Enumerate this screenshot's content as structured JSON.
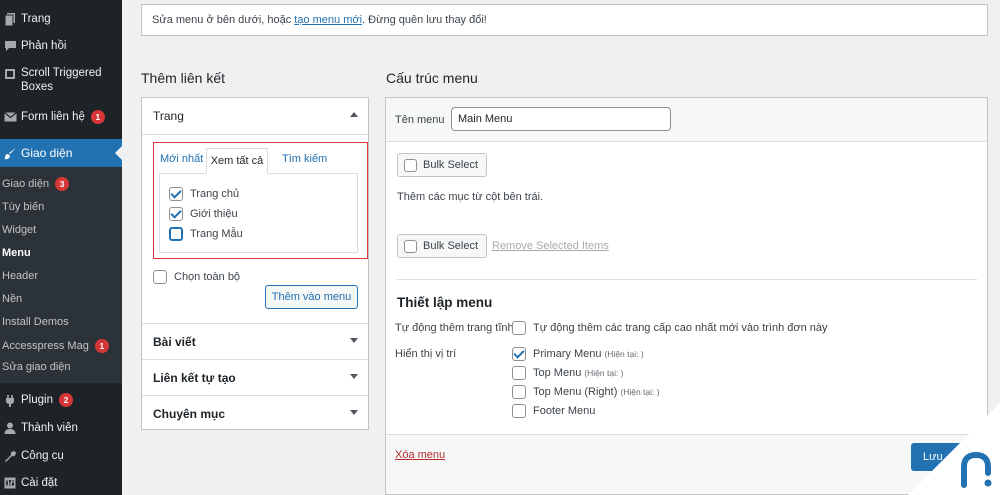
{
  "sidebar": {
    "items": [
      {
        "label": "Trang",
        "icon": "page-icon"
      },
      {
        "label": "Phản hồi",
        "icon": "comment-icon"
      },
      {
        "label": "Scroll Triggered Boxes",
        "icon": "box-icon"
      },
      {
        "label": "Form liên hệ",
        "icon": "mail-icon",
        "badge": "1"
      },
      {
        "label": "Giao diện",
        "icon": "brush-icon"
      },
      {
        "label": "Plugin",
        "icon": "plugin-icon",
        "badge": "2"
      },
      {
        "label": "Thành viên",
        "icon": "user-icon"
      },
      {
        "label": "Công cụ",
        "icon": "wrench-icon"
      },
      {
        "label": "Cài đặt",
        "icon": "settings-icon"
      }
    ],
    "submenu": [
      {
        "label": "Giao diện",
        "badge": "3"
      },
      {
        "label": "Tùy biến"
      },
      {
        "label": "Widget"
      },
      {
        "label": "Menu"
      },
      {
        "label": "Header"
      },
      {
        "label": "Nền"
      },
      {
        "label": "Install Demos"
      },
      {
        "label": "Accesspress Mag",
        "badge": "1"
      },
      {
        "label": "Sửa giao diện"
      }
    ]
  },
  "notice": {
    "before": "Sửa menu ở bên dưới, hoặc ",
    "link": "tạo menu mới",
    "after": ". Đừng quên lưu thay đổi!"
  },
  "add_links": {
    "title": "Thêm liên kết",
    "pages_section": "Trang",
    "tabs": [
      "Mới nhất",
      "Xem tất cả",
      "Tìm kiếm"
    ],
    "pages": [
      {
        "label": "Trang chủ",
        "checked": true
      },
      {
        "label": "Giới thiệu",
        "checked": true
      },
      {
        "label": "Trang Mẫu",
        "checked": false
      }
    ],
    "select_all": "Chọn toàn bộ",
    "add_button": "Thêm vào menu",
    "sections": [
      "Bài viết",
      "Liên kết tự tạo",
      "Chuyên mục"
    ]
  },
  "menu_structure": {
    "title": "Cấu trúc menu",
    "name_label": "Tên menu",
    "name_value": "Main Menu",
    "bulk_select": "Bulk Select",
    "hint": "Thêm các mục từ cột bên trái.",
    "remove_selected": "Remove Selected Items",
    "settings_title": "Thiết lập menu",
    "auto_add_label": "Tự động thêm trang tĩnh",
    "auto_add_option": "Tự động thêm các trang cấp cao nhất mới vào trình đơn này",
    "display_label": "Hiển thị vị trí",
    "locations": [
      {
        "label": "Primary Menu",
        "note": "(Hiện tại: )",
        "checked": true
      },
      {
        "label": "Top Menu",
        "note": "(Hiện tại: )",
        "checked": false
      },
      {
        "label": "Top Menu (Right)",
        "note": "(Hiện tại: )",
        "checked": false
      },
      {
        "label": "Footer Menu",
        "note": "",
        "checked": false
      }
    ],
    "delete_link": "Xóa menu",
    "save_button": "Lưu"
  },
  "colors": {
    "accent": "#2271b1",
    "sidebar": "#1d2327",
    "badge": "#d63638"
  }
}
